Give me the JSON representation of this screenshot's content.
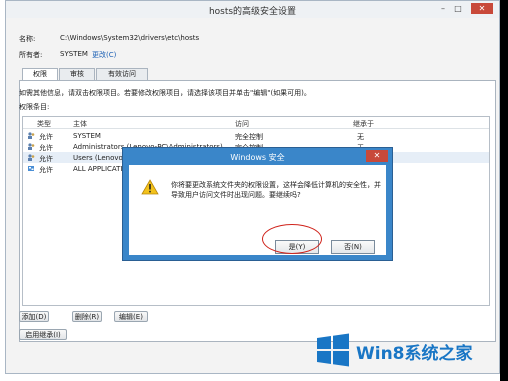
{
  "window": {
    "title": "hosts的高级安全设置",
    "controls": [
      "–",
      "□",
      "✕"
    ]
  },
  "info": {
    "name_label": "名称:",
    "name_value": "C:\\Windows\\System32\\drivers\\etc\\hosts",
    "owner_label": "所有者:",
    "owner_value": "SYSTEM",
    "owner_change": "更改(C)"
  },
  "tabs": [
    "权限",
    "审核",
    "有效访问"
  ],
  "instruction": "如需其他信息，请双击权限项目。若要修改权限项目，请选择该项目并单击\"编辑\"(如果可用)。",
  "perm_label": "权限条目:",
  "table": {
    "headers": [
      "类型",
      "主体",
      "访问",
      "继承于"
    ],
    "rows": [
      {
        "type": "允许",
        "principal": "SYSTEM",
        "access": "完全控制",
        "inherit": "无"
      },
      {
        "type": "允许",
        "principal": "Administrators (Lenovo-PC\\Administrators)",
        "access": "完全控制",
        "inherit": "无"
      },
      {
        "type": "允许",
        "principal": "Users (Lenovo-PC",
        "access": "",
        "inherit": ""
      },
      {
        "type": "允许",
        "principal": "ALL APPLICATION",
        "access": "",
        "inherit": ""
      }
    ]
  },
  "buttons": {
    "add": "添加(D)",
    "remove": "删除(R)",
    "edit": "编辑(E)",
    "enable_inherit": "启用继承(I)"
  },
  "dialog": {
    "title": "Windows 安全",
    "close": "✕",
    "message": "你将要更改系统文件夹的权限设置，这样会降低计算机的安全性，并导致用户访问文件时出现问题。要继续吗?",
    "yes": "是(Y)",
    "no": "否(N)"
  },
  "brand": {
    "text": "Win8系统之家",
    "color": "#1976c5"
  }
}
